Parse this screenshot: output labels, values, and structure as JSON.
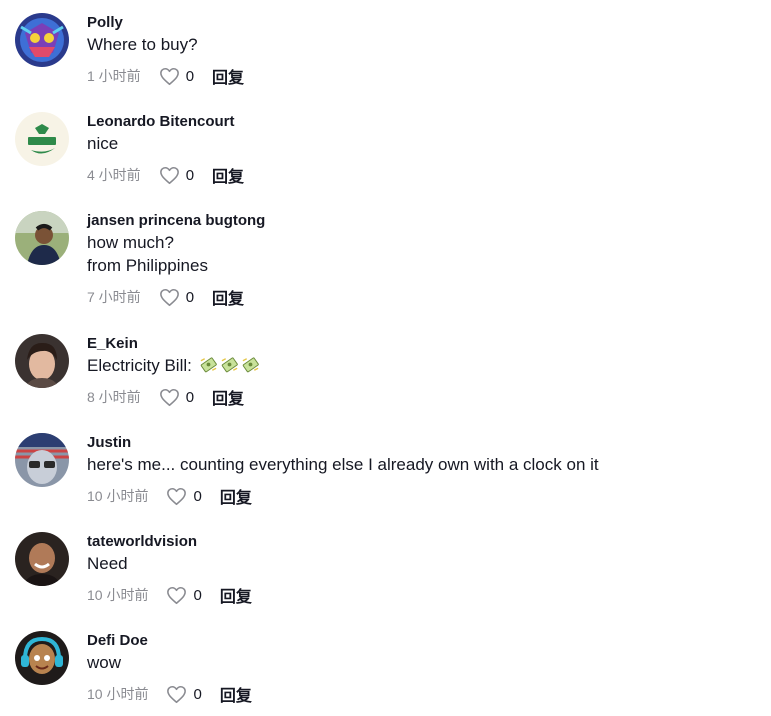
{
  "comments": [
    {
      "username": "Polly",
      "lines": [
        "Where to buy?"
      ],
      "time": "1 小时前",
      "likes": "0",
      "reply": "回复",
      "avatar": "colorful-mask"
    },
    {
      "username": "Leonardo Bitencourt",
      "lines": [
        "nice"
      ],
      "time": "4 小时前",
      "likes": "0",
      "reply": "回复",
      "avatar": "green-logo"
    },
    {
      "username": "jansen princena bugtong",
      "lines": [
        "how much?",
        "from Philippines"
      ],
      "time": "7 小时前",
      "likes": "0",
      "reply": "回复",
      "avatar": "photo-person-outdoors"
    },
    {
      "username": "E_Kein",
      "lines": [
        "Electricity Bill: "
      ],
      "emoji": "money-with-wings-emoji",
      "emoji_count": 3,
      "time": "8 小时前",
      "likes": "0",
      "reply": "回复",
      "avatar": "photo-person-portrait"
    },
    {
      "username": "Justin",
      "lines": [
        "here's me... counting everything else I already own with a clock on it"
      ],
      "time": "10 小时前",
      "likes": "0",
      "reply": "回复",
      "avatar": "flag-face"
    },
    {
      "username": "tateworldvision",
      "lines": [
        "Need"
      ],
      "time": "10 小时前",
      "likes": "0",
      "reply": "回复",
      "avatar": "photo-man-smiling"
    },
    {
      "username": "Defi Doe",
      "lines": [
        "wow"
      ],
      "time": "10 小时前",
      "likes": "0",
      "reply": "回复",
      "avatar": "cartoon-headphones"
    }
  ],
  "colors": {
    "text": "#161823",
    "muted": "#8a8b91",
    "heart_outline": "#8a8b91"
  }
}
